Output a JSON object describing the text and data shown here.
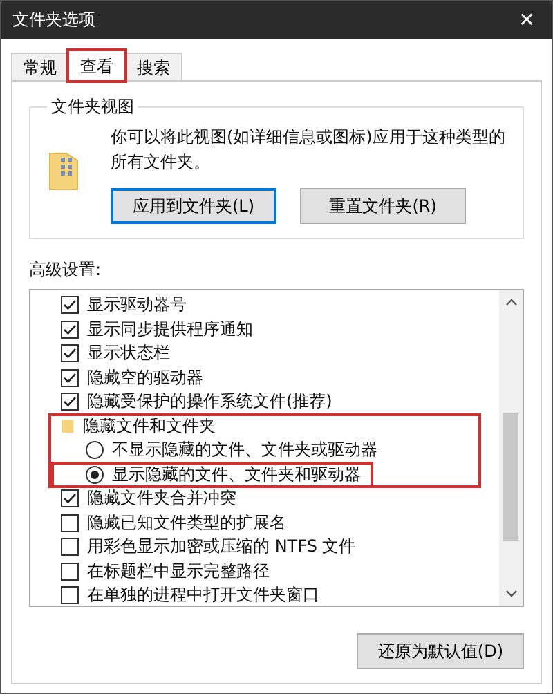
{
  "window": {
    "title": "文件夹选项",
    "close": "✕"
  },
  "tabs": [
    {
      "label": "常规",
      "selected": false,
      "highlighted": false
    },
    {
      "label": "查看",
      "selected": true,
      "highlighted": true
    },
    {
      "label": "搜索",
      "selected": false,
      "highlighted": false
    }
  ],
  "folder_views": {
    "title": "文件夹视图",
    "description": "你可以将此视图(如详细信息或图标)应用于这种类型的所有文件夹。",
    "buttons": [
      {
        "label": "应用到文件夹(L)",
        "focused": true
      },
      {
        "label": "重置文件夹(R)",
        "focused": false
      }
    ]
  },
  "advanced": {
    "title": "高级设置:",
    "items": [
      {
        "kind": "checkbox",
        "label": "显示驱动器号",
        "checked": true,
        "highlighted": false
      },
      {
        "kind": "checkbox",
        "label": "显示同步提供程序通知",
        "checked": true,
        "highlighted": false
      },
      {
        "kind": "checkbox",
        "label": "显示状态栏",
        "checked": true,
        "highlighted": false
      },
      {
        "kind": "checkbox",
        "label": "隐藏空的驱动器",
        "checked": true,
        "highlighted": false
      },
      {
        "kind": "checkbox",
        "label": "隐藏受保护的操作系统文件(推荐)",
        "checked": true,
        "highlighted": false
      },
      {
        "kind": "group",
        "label": "隐藏文件和文件夹",
        "highlighted": true,
        "children": [
          {
            "kind": "radio",
            "label": "不显示隐藏的文件、文件夹或驱动器",
            "selected": false,
            "highlighted": false
          },
          {
            "kind": "radio",
            "label": "显示隐藏的文件、文件夹和驱动器",
            "selected": true,
            "highlighted": true
          }
        ]
      },
      {
        "kind": "checkbox",
        "label": "隐藏文件夹合并冲突",
        "checked": true,
        "highlighted": false
      },
      {
        "kind": "checkbox",
        "label": "隐藏已知文件类型的扩展名",
        "checked": false,
        "highlighted": false
      },
      {
        "kind": "checkbox",
        "label": "用彩色显示加密或压缩的 NTFS 文件",
        "checked": false,
        "highlighted": false
      },
      {
        "kind": "checkbox",
        "label": "在标题栏中显示完整路径",
        "checked": false,
        "highlighted": false
      },
      {
        "kind": "checkbox",
        "label": "在单独的进程中打开文件夹窗口",
        "checked": false,
        "highlighted": false
      }
    ]
  },
  "restore_button": "还原为默认值(D)"
}
